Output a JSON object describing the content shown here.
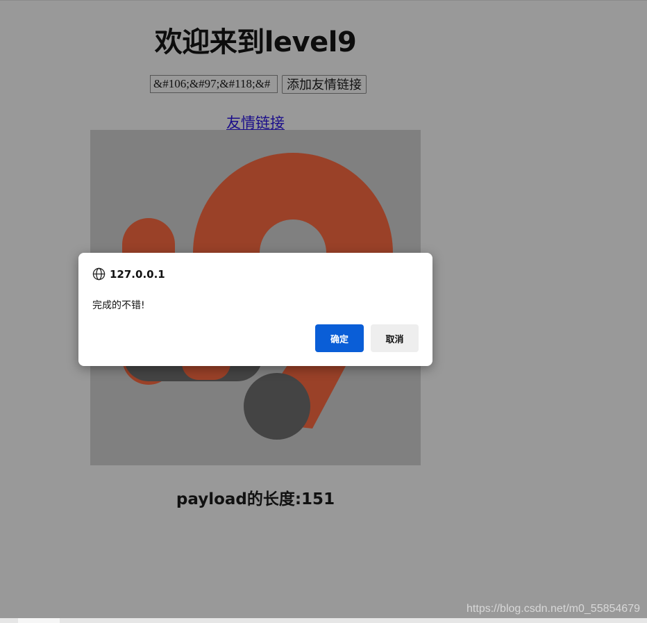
{
  "page": {
    "title": "欢迎来到level9",
    "input_value": "&#106;&#97;&#118;&#",
    "submit_label": "添加友情链接",
    "friend_link": "友情链接",
    "payload_length": "payload的长度:151",
    "watermark": "https://blog.csdn.net/m0_55854679"
  },
  "dialog": {
    "origin": "127.0.0.1",
    "message": "完成的不错!",
    "ok_label": "确定",
    "cancel_label": "取消"
  },
  "colors": {
    "overlay_bg": "#999999",
    "logo_orange": "#9a4128",
    "logo_dark": "#444444",
    "ok_button": "#0a5ed7"
  },
  "icons": {
    "dialog_origin": "globe-icon"
  }
}
